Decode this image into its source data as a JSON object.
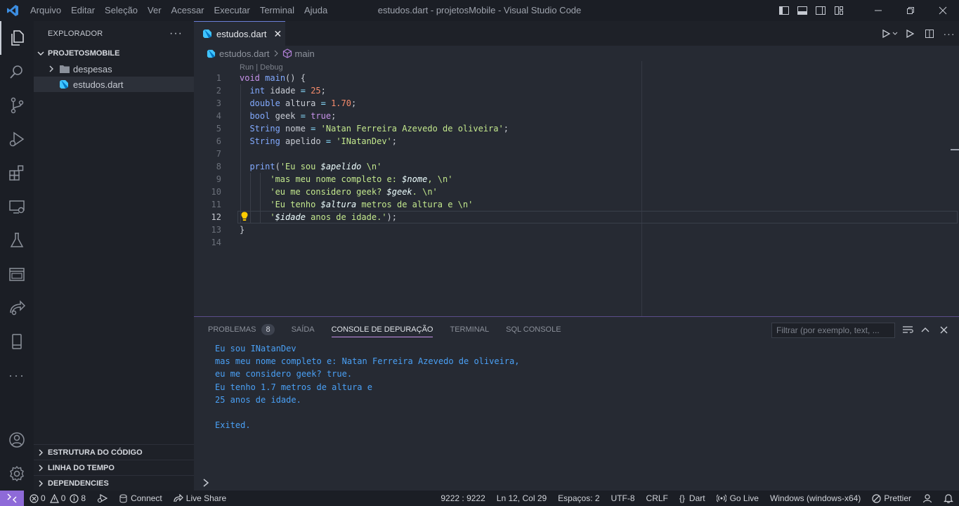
{
  "titlebar": {
    "menu": [
      "Arquivo",
      "Editar",
      "Seleção",
      "Ver",
      "Acessar",
      "Executar",
      "Terminal",
      "Ajuda"
    ],
    "window_title": "estudos.dart - projetosMobile - Visual Studio Code"
  },
  "sidebar": {
    "title": "EXPLORADOR",
    "more": "···",
    "project": "PROJETOSMOBILE",
    "items": [
      {
        "label": "despesas",
        "icon": "folder-icon"
      },
      {
        "label": "estudos.dart",
        "icon": "dart-file-icon"
      }
    ],
    "bottom_sections": [
      "ESTRUTURA DO CÓDIGO",
      "LINHA DO TEMPO",
      "DEPENDENCIES"
    ]
  },
  "editor": {
    "tab_label": "estudos.dart",
    "tab_close": "✕",
    "breadcrumb": {
      "file": "estudos.dart",
      "symbol": "main"
    },
    "codelens": "Run | Debug",
    "current_line": 12,
    "line_numbers": [
      "1",
      "2",
      "3",
      "4",
      "5",
      "6",
      "7",
      "8",
      "9",
      "10",
      "11",
      "12",
      "13",
      "14"
    ]
  },
  "panel": {
    "tabs": [
      "PROBLEMAS",
      "SAÍDA",
      "CONSOLE DE DEPURAÇÃO",
      "TERMINAL",
      "SQL CONSOLE"
    ],
    "problems_count": "8",
    "active_tab": "CONSOLE DE DEPURAÇÃO",
    "filter_placeholder": "Filtrar (por exemplo, text, ...",
    "console_lines": [
      "Eu sou INatanDev",
      "mas meu nome completo e: Natan Ferreira Azevedo de oliveira,",
      "eu me considero geek? true.",
      "Eu tenho 1.7 metros de altura e",
      "25 anos de idade.",
      "",
      "Exited."
    ]
  },
  "statusbar": {
    "errors": "0",
    "warnings": "0",
    "infos": "8",
    "connect": "Connect",
    "live_share": "Live Share",
    "port": "9222 : 9222",
    "position": "Ln 12, Col 29",
    "spaces": "Espaços: 2",
    "encoding": "UTF-8",
    "eol": "CRLF",
    "language": "Dart",
    "go_live": "Go Live",
    "platform": "Windows (windows-x64)",
    "prettier": "Prettier"
  },
  "colors": {
    "accent": "#8e6ad8",
    "console_text": "#4aa0f5",
    "keyword": "#c792ea",
    "string": "#c3e88d",
    "number": "#f78c6c"
  }
}
